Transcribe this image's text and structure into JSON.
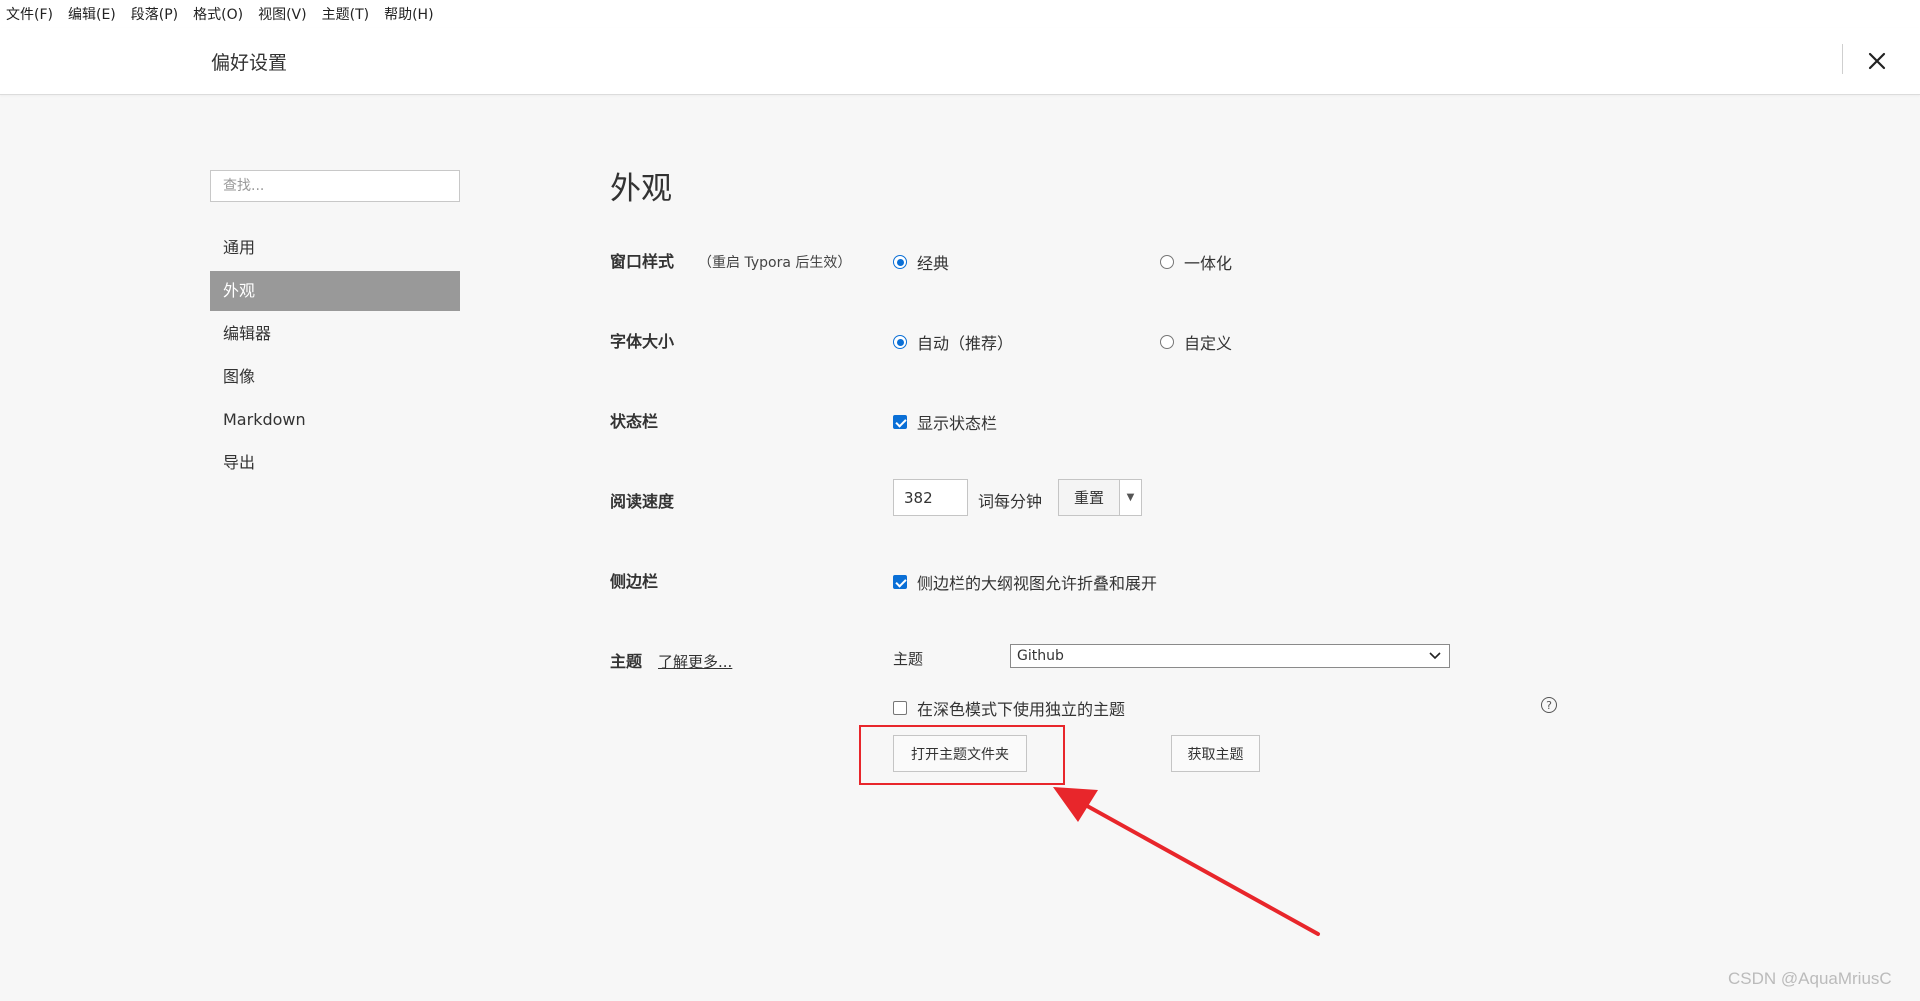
{
  "menu": [
    "文件(F)",
    "编辑(E)",
    "段落(P)",
    "格式(O)",
    "视图(V)",
    "主题(T)",
    "帮助(H)"
  ],
  "header": {
    "title": "偏好设置",
    "close_icon": "close-icon"
  },
  "search": {
    "placeholder": "查找..."
  },
  "sidebar": {
    "items": [
      {
        "label": "通用",
        "active": false
      },
      {
        "label": "外观",
        "active": true
      },
      {
        "label": "编辑器",
        "active": false
      },
      {
        "label": "图像",
        "active": false
      },
      {
        "label": "Markdown",
        "active": false
      },
      {
        "label": "导出",
        "active": false
      }
    ]
  },
  "main": {
    "title": "外观",
    "window_style": {
      "label": "窗口样式",
      "note": "（重启 Typora 后生效）",
      "options": [
        "经典",
        "一体化"
      ],
      "selected": "经典"
    },
    "font_size": {
      "label": "字体大小",
      "options": [
        "自动（推荐）",
        "自定义"
      ],
      "selected": "自动（推荐）"
    },
    "status_bar": {
      "label": "状态栏",
      "checkbox": "显示状态栏",
      "checked": true
    },
    "reading_speed": {
      "label": "阅读速度",
      "value": "382",
      "unit": "词每分钟",
      "reset": "重置"
    },
    "sidebar_opt": {
      "label": "侧边栏",
      "checkbox": "侧边栏的大纲视图允许折叠和展开",
      "checked": true
    },
    "theme": {
      "label": "主题",
      "learn_more": "了解更多...",
      "select_label": "主题",
      "selected": "Github",
      "dark_checkbox": "在深色模式下使用独立的主题",
      "dark_checked": false,
      "open_folder": "打开主题文件夹",
      "get_themes": "获取主题"
    }
  },
  "watermark": "CSDN @AquaMriusC",
  "colors": {
    "accent": "#0a6fd6",
    "annotation": "#e8262b",
    "active_sidebar": "#999999"
  }
}
